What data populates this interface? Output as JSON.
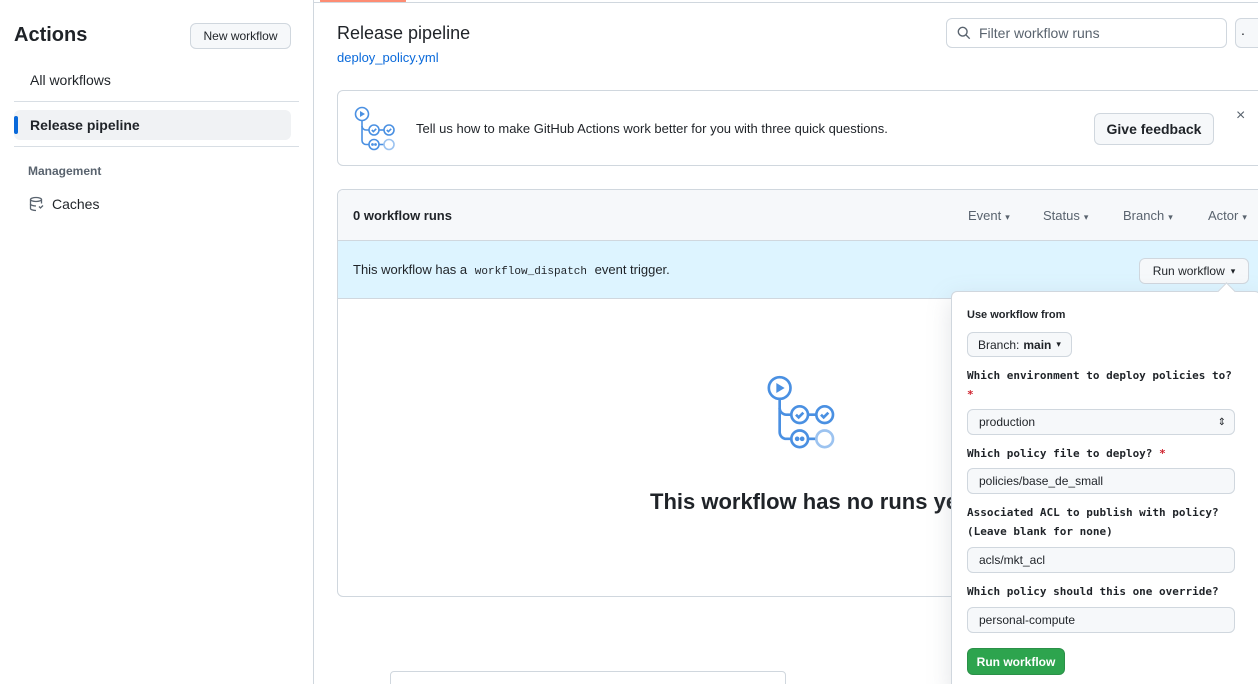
{
  "sidebar": {
    "title": "Actions",
    "new_workflow": "New workflow",
    "all_workflows": "All workflows",
    "active_workflow": "Release pipeline",
    "section": "Management",
    "caches": "Caches"
  },
  "header": {
    "title": "Release pipeline",
    "file": "deploy_policy.yml",
    "filter_placeholder": "Filter workflow runs",
    "more": "·"
  },
  "feedback": {
    "text": "Tell us how to make GitHub Actions work better for you with three quick questions.",
    "button": "Give feedback",
    "close": "×"
  },
  "runs": {
    "count": "0 workflow runs",
    "filters": [
      "Event",
      "Status",
      "Branch",
      "Actor"
    ],
    "dispatch_before": "This workflow has a",
    "dispatch_code": "workflow_dispatch",
    "dispatch_after": "event trigger.",
    "run_button": "Run workflow",
    "empty_title": "This workflow has no runs yet"
  },
  "popup": {
    "use_from": "Use workflow from",
    "branch_label": "Branch:",
    "branch_value": "main",
    "q1": "Which environment to deploy policies to?",
    "q1_value": "production",
    "q2": "Which policy file to deploy?",
    "q2_value": "policies/base_de_small",
    "q3": "Associated ACL to publish with policy? (Leave blank for none)",
    "q3_value": "acls/mkt_acl",
    "q4": "Which policy should this one override?",
    "q4_value": "personal-compute",
    "required_mark": "*",
    "run_button": "Run workflow"
  },
  "colors": {
    "accent": "#0969da",
    "run_green": "#2da44e",
    "info_bg": "#ddf4ff",
    "required": "#cf222e",
    "icon_blue": "#4a90e2"
  }
}
